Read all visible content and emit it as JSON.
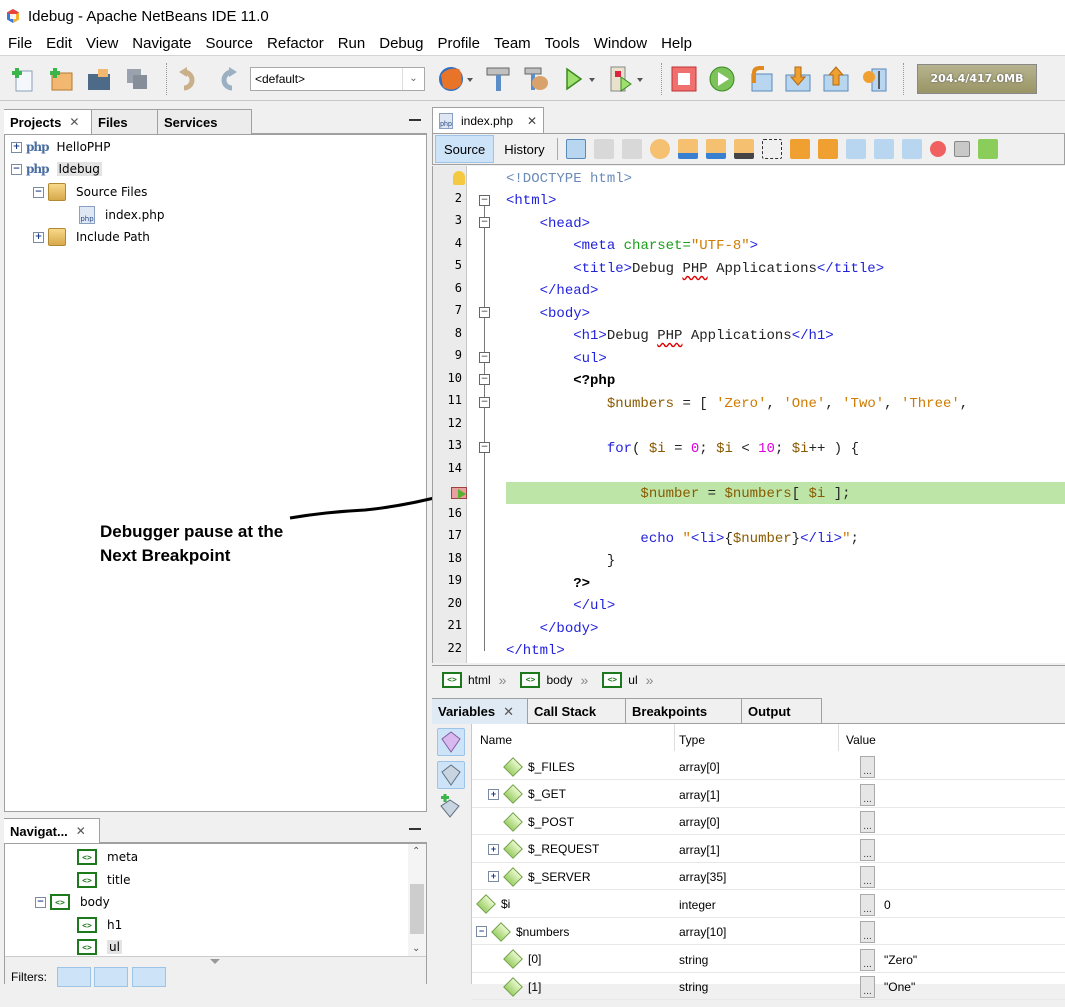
{
  "window": {
    "title": "Idebug - Apache NetBeans IDE 11.0",
    "logo_icon": "netbeans-cube-icon"
  },
  "menu": [
    "File",
    "Edit",
    "View",
    "Navigate",
    "Source",
    "Refactor",
    "Run",
    "Debug",
    "Profile",
    "Team",
    "Tools",
    "Window",
    "Help"
  ],
  "toolbar": {
    "config_select": "<default>",
    "memory": "204.4/417.0MB",
    "icons": [
      "new-file-icon",
      "new-project-icon",
      "open-project-icon",
      "save-all-icon",
      "undo-icon",
      "redo-icon",
      "firefox-browser-icon",
      "build-hammer-icon",
      "clean-build-icon",
      "run-icon",
      "debug-file-icon",
      "finish-debugger-icon",
      "continue-icon",
      "step-over-icon",
      "step-into-icon",
      "step-out-icon",
      "run-to-cursor-icon"
    ]
  },
  "projects_panel": {
    "tabs": [
      {
        "label": "Projects",
        "closable": true
      },
      {
        "label": "Files"
      },
      {
        "label": "Services"
      }
    ],
    "tree": [
      {
        "label": "HelloPHP",
        "type": "project",
        "expanded": false
      },
      {
        "label": "Idebug",
        "type": "project",
        "expanded": true,
        "selected": true
      },
      {
        "label": "Source Files",
        "type": "folder",
        "expanded": true
      },
      {
        "label": "index.php",
        "type": "file"
      },
      {
        "label": "Include Path",
        "type": "folder",
        "expanded": false
      }
    ]
  },
  "navigator_panel": {
    "tab": "Navigat...",
    "tree": [
      {
        "label": "meta"
      },
      {
        "label": "title"
      },
      {
        "label": "body",
        "expanded": true
      },
      {
        "label": "h1"
      },
      {
        "label": "ul",
        "selected": true
      }
    ],
    "filters_label": "Filters:"
  },
  "annotation": {
    "line1": "Debugger pause at the",
    "line2": "Next Breakpoint"
  },
  "editor": {
    "tab": "index.php",
    "source_label": "Source",
    "history_label": "History",
    "line_numbers": [
      "",
      "2",
      "3",
      "4",
      "5",
      "6",
      "7",
      "8",
      "9",
      "10",
      "11",
      "12",
      "13",
      "14",
      "",
      "16",
      "17",
      "18",
      "19",
      "20",
      "21",
      "22"
    ],
    "current_line": 15,
    "breadcrumb": [
      "html",
      "body",
      "ul"
    ]
  },
  "debug_panel": {
    "tabs": [
      {
        "label": "Variables",
        "closable": true
      },
      {
        "label": "Call Stack"
      },
      {
        "label": "Breakpoints"
      },
      {
        "label": "Output"
      }
    ],
    "columns": [
      "Name",
      "Type",
      "Value"
    ],
    "rows": [
      {
        "name": "$_FILES",
        "type": "array[0]",
        "value": "",
        "expandable": false,
        "indent": 1
      },
      {
        "name": "$_GET",
        "type": "array[1]",
        "value": "",
        "expandable": true,
        "indent": 1
      },
      {
        "name": "$_POST",
        "type": "array[0]",
        "value": "",
        "expandable": false,
        "indent": 1
      },
      {
        "name": "$_REQUEST",
        "type": "array[1]",
        "value": "",
        "expandable": true,
        "indent": 1
      },
      {
        "name": "$_SERVER",
        "type": "array[35]",
        "value": "",
        "expandable": true,
        "indent": 1
      },
      {
        "name": "$i",
        "type": "integer",
        "value": "0",
        "expandable": false,
        "indent": 0
      },
      {
        "name": "$numbers",
        "type": "array[10]",
        "value": "",
        "expandable": true,
        "expanded": true,
        "indent": 0
      },
      {
        "name": "[0]",
        "type": "string",
        "value": "\"Zero\"",
        "expandable": false,
        "indent": 1
      },
      {
        "name": "[1]",
        "type": "string",
        "value": "\"One\"",
        "expandable": false,
        "indent": 1
      }
    ]
  }
}
